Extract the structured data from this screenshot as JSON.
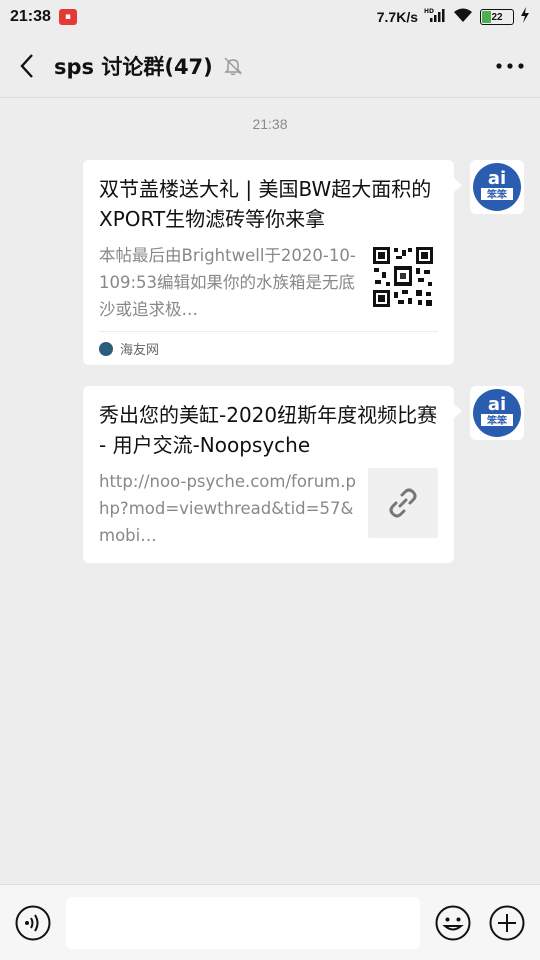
{
  "status_bar": {
    "time": "21:38",
    "network_speed": "7.7K/s",
    "battery_level": "22",
    "icons": [
      "notification-icon",
      "hd-signal-icon",
      "wifi-icon",
      "battery-icon",
      "charging-icon"
    ]
  },
  "header": {
    "title": "sps 讨论群(47)",
    "icons": [
      "back-icon",
      "mute-bell-icon",
      "more-icon"
    ]
  },
  "chat": {
    "timestamp": "21:38",
    "messages": [
      {
        "title": "双节盖楼送大礼 | 美国BW超大面积的XPORT生物滤砖等你来拿",
        "description": "本帖最后由Brightwell于2020-10-109:53编辑如果你的水族箱是无底沙或追求极…",
        "thumbnail": "qr-code",
        "source": "海友网"
      },
      {
        "title": "秀出您的美缸-2020纽斯年度视频比赛 - 用户交流-Noopsyche",
        "description": "http://noo-psyche.com/forum.php?mod=viewthread&tid=57&mobi…",
        "thumbnail": "link-icon"
      }
    ]
  },
  "bottom_bar": {
    "input_placeholder": "",
    "icons": [
      "voice-icon",
      "emoji-icon",
      "plus-icon"
    ]
  },
  "colors": {
    "background": "#ededed",
    "card": "#ffffff",
    "avatar_blue": "#2a5db0"
  }
}
